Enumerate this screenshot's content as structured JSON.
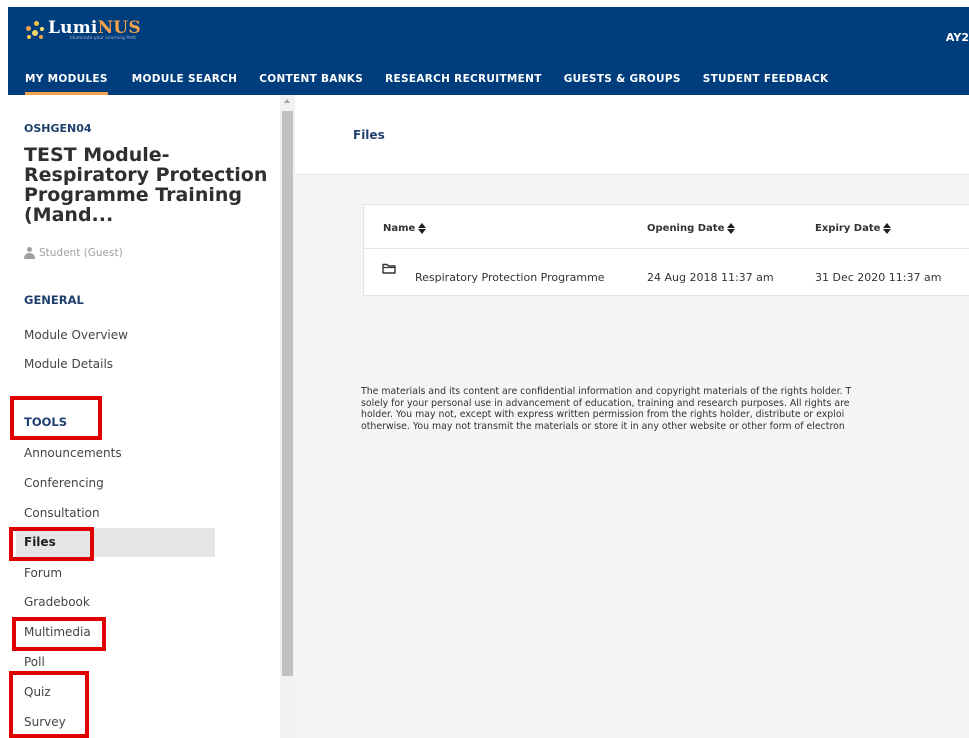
{
  "header": {
    "logo_text_main": "Lumi",
    "logo_text_accent": "NUS",
    "logo_tagline": "Illuminate your Learning Path",
    "academic_year": "AY2",
    "nav": [
      {
        "label": "MY MODULES",
        "active": true
      },
      {
        "label": "MODULE SEARCH",
        "active": false
      },
      {
        "label": "CONTENT BANKS",
        "active": false
      },
      {
        "label": "RESEARCH RECRUITMENT",
        "active": false
      },
      {
        "label": "GUESTS & GROUPS",
        "active": false
      },
      {
        "label": "STUDENT FEEDBACK",
        "active": false
      }
    ],
    "colors": {
      "bar": "#003d7c",
      "accent": "#f4a24a"
    }
  },
  "sidebar": {
    "module_code": "OSHGEN04",
    "module_title": "TEST Module-Respiratory Protection Programme Training (Mand...",
    "role": "Student (Guest)",
    "general_heading": "GENERAL",
    "general_items": [
      "Module Overview",
      "Module Details"
    ],
    "tools_heading": "TOOLS",
    "tool_items": [
      "Announcements",
      "Conferencing",
      "Consultation",
      "Files",
      "Forum",
      "Gradebook",
      "Multimedia",
      "Poll",
      "Quiz",
      "Survey"
    ],
    "active_item": "Files"
  },
  "main": {
    "title": "Files",
    "table": {
      "columns": [
        "Name",
        "Opening Date",
        "Expiry Date"
      ],
      "rows": [
        {
          "icon": "folder-icon",
          "name": "Respiratory Protection Programme",
          "opening": "24 Aug 2018 11:37 am",
          "expiry": "31 Dec 2020 11:37 am"
        }
      ]
    },
    "disclaimer": [
      "The materials and its content are confidential information and copyright materials of the rights holder. T",
      "solely for your personal use in advancement of education, training and research purposes. All rights are",
      "holder. You may not, except with express written permission from the rights holder, distribute or exploi",
      "otherwise. You may not transmit the materials or store it in any other website or other form of electron"
    ]
  },
  "annotation_color": "#e00000"
}
